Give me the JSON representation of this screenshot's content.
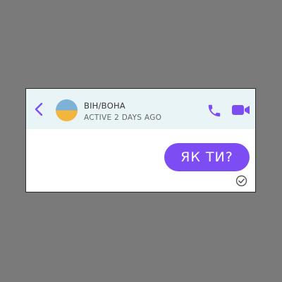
{
  "conversation": {
    "contact_name": "ВІН/ВОНА",
    "contact_status": "ACTIVE 2 DAYS AGO"
  },
  "messages": [
    {
      "text": "ЯК ТИ?",
      "from": "me",
      "status": "seen"
    }
  ],
  "icons": {
    "back": "chevron-left-icon",
    "call": "phone-icon",
    "video": "video-camera-icon",
    "receipt": "check-circle-icon"
  },
  "colors": {
    "accent": "#7d4cf2",
    "header_background": "#e9f4f6",
    "avatar_top": "#7db2d6",
    "avatar_bottom": "#f4b53f"
  }
}
